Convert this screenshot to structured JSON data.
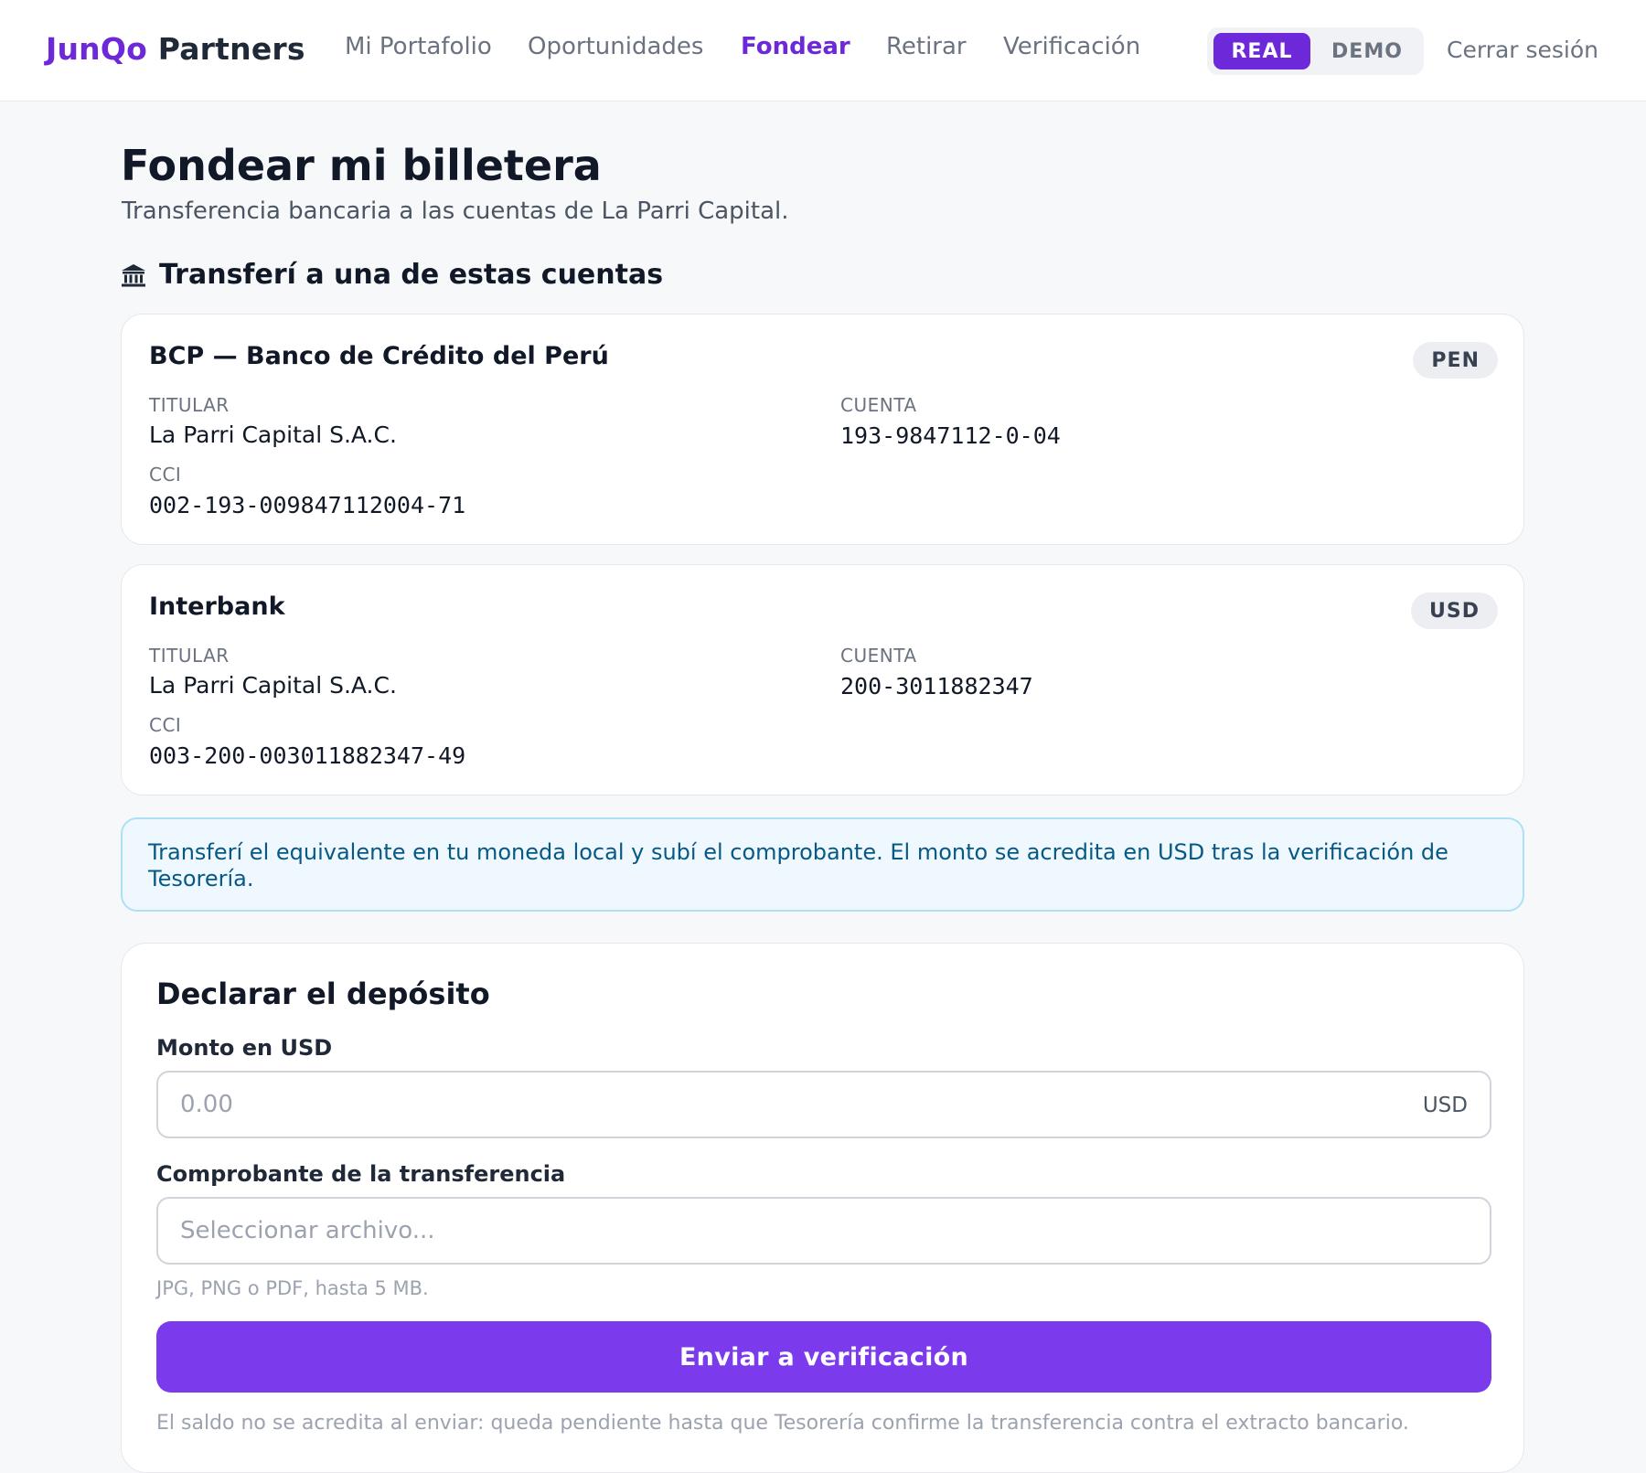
{
  "brand": {
    "part1": "JunQo",
    "part2": "Partners"
  },
  "nav": [
    {
      "label": "Mi Portafolio",
      "active": false
    },
    {
      "label": "Oportunidades",
      "active": false
    },
    {
      "label": "Fondear",
      "active": true
    },
    {
      "label": "Retirar",
      "active": false
    },
    {
      "label": "Verificación",
      "active": false
    }
  ],
  "mode_toggle": {
    "real": "REAL",
    "demo": "DEMO",
    "selected": "REAL"
  },
  "logout_label": "Cerrar sesión",
  "page": {
    "title": "Fondear mi billetera",
    "subtitle": "Transferencia bancaria a las cuentas de La Parri Capital."
  },
  "accounts_section": {
    "icon": "bank-icon",
    "title": "Transferí a una de estas cuentas",
    "accounts": [
      {
        "bank": "BCP — Banco de Crédito del Perú",
        "currency": "PEN",
        "holder_label": "TITULAR",
        "holder": "La Parri Capital S.A.C.",
        "account_label": "CUENTA",
        "account": "193-9847112-0-04",
        "cci_label": "CCI",
        "cci": "002-193-009847112004-71"
      },
      {
        "bank": "Interbank",
        "currency": "USD",
        "holder_label": "TITULAR",
        "holder": "La Parri Capital S.A.C.",
        "account_label": "CUENTA",
        "account": "200-3011882347",
        "cci_label": "CCI",
        "cci": "003-200-003011882347-49"
      }
    ]
  },
  "info_note": "Transferí el equivalente en tu moneda local y subí el comprobante. El monto se acredita en USD tras la verificación de Tesorería.",
  "deposit_form": {
    "title": "Declarar el depósito",
    "amount_label": "Monto en USD",
    "amount_placeholder": "0.00",
    "amount_value": "",
    "amount_suffix": "USD",
    "receipt_label": "Comprobante de la transferencia",
    "receipt_placeholder": "Seleccionar archivo...",
    "receipt_hint": "JPG, PNG o PDF, hasta 5 MB.",
    "submit_label": "Enviar a verificación",
    "footnote": "El saldo no se acredita al enviar: queda pendiente hasta que Tesorería confirme la transferencia contra el extracto bancario."
  },
  "colors": {
    "brand": "#6d28d9",
    "primary_button": "#7c3aed",
    "info_bg": "#eff8fe",
    "info_border": "#aee0f5",
    "info_text": "#075985",
    "page_bg": "#f7f8fa"
  }
}
